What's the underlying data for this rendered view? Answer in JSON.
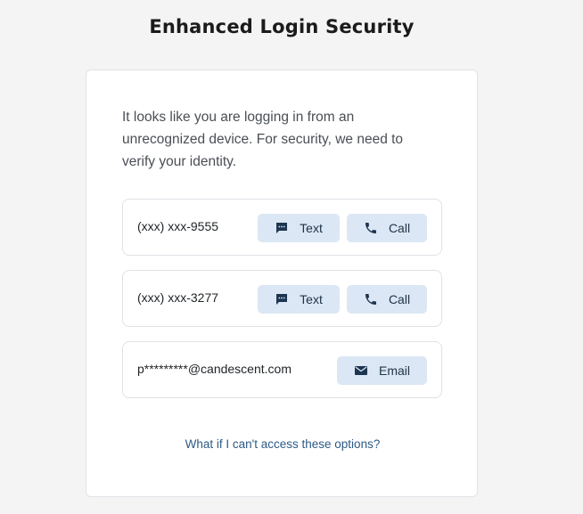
{
  "page": {
    "title": "Enhanced Login Security"
  },
  "card": {
    "intro": "It looks like you are logging in from an unrecognized device. For security, we need to verify your identity.",
    "options": [
      {
        "contact": "(xxx) xxx-9555",
        "text_label": "Text",
        "call_label": "Call"
      },
      {
        "contact": "(xxx) xxx-3277",
        "text_label": "Text",
        "call_label": "Call"
      },
      {
        "contact": "p*********@candescent.com",
        "email_label": "Email"
      }
    ],
    "help_link": "What if I can't access these options?"
  },
  "icons": {
    "text": "chat-bubble-icon",
    "call": "phone-icon",
    "email": "envelope-icon"
  },
  "colors": {
    "button_bg": "#dbe7f4",
    "icon": "#1d3550",
    "link": "#2c5a86",
    "title": "#1b1b1b"
  }
}
